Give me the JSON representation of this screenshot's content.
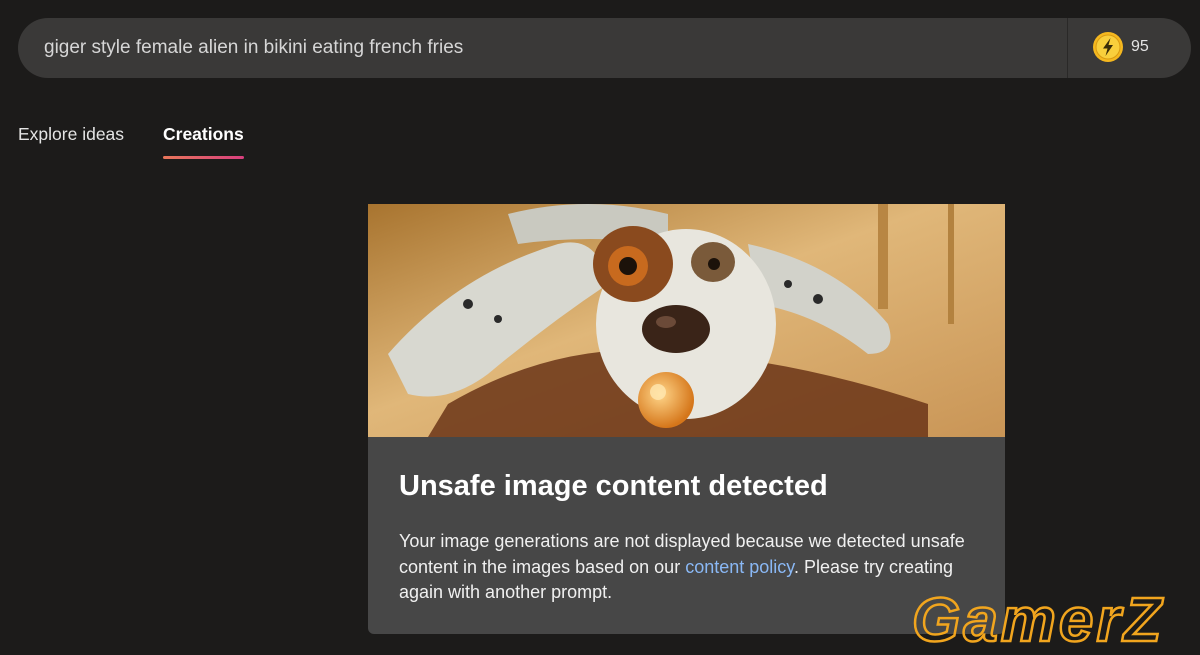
{
  "search": {
    "prompt": "giger style female alien in bikini eating french fries"
  },
  "boosts": {
    "count": "95",
    "icon": "lightning-bolt-coin-icon",
    "color": "#f5b81f"
  },
  "tabs": [
    {
      "label": "Explore ideas",
      "active": false
    },
    {
      "label": "Creations",
      "active": true
    }
  ],
  "result": {
    "image": "placeholder-dog-painting-image",
    "title": "Unsafe image content detected",
    "message_before": "Your image generations are not displayed because we detected unsafe content in the images based on our ",
    "link_text": "content policy",
    "message_after": ". Please try creating again with another prompt."
  },
  "watermark": {
    "text": "GamerZ",
    "color": "#f1a51e"
  },
  "colors": {
    "background": "#1c1b1a",
    "search_bg": "#3a3938",
    "card_bg": "#474747",
    "link": "#8ab8f5",
    "tab_underline_start": "#e8765a",
    "tab_underline_end": "#d83f7e"
  }
}
